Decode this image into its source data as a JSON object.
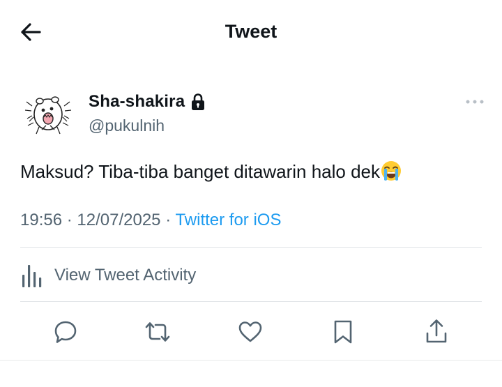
{
  "header": {
    "title": "Tweet",
    "back_icon": "arrow-left-icon"
  },
  "tweet": {
    "author": {
      "display_name": "Sha-shakira",
      "handle": "@pukulnih",
      "protected_icon": "lock-icon",
      "avatar": "hamster-avatar"
    },
    "text": "Maksud? Tiba-tiba banget ditawarin halo dek",
    "emoji": "loudly-crying-face-emoji",
    "time": "19:56",
    "date": "12/07/2025",
    "separator": "·",
    "source": "Twitter for iOS"
  },
  "activity": {
    "label": "View Tweet Activity",
    "icon": "bar-chart-icon"
  },
  "actions": [
    {
      "name": "reply",
      "icon": "reply-icon"
    },
    {
      "name": "retweet",
      "icon": "retweet-icon"
    },
    {
      "name": "like",
      "icon": "heart-icon"
    },
    {
      "name": "bookmark",
      "icon": "bookmark-icon"
    },
    {
      "name": "share",
      "icon": "share-icon"
    }
  ],
  "colors": {
    "text": "#0f1419",
    "secondary": "#536471",
    "link": "#1d9bf0",
    "divider": "#dfe3e6",
    "icon": "#536471"
  }
}
